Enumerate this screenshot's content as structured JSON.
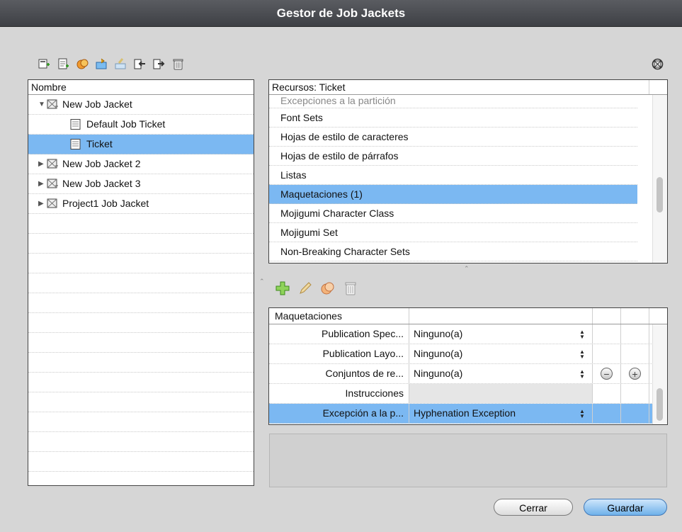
{
  "window": {
    "title": "Gestor de Job Jackets"
  },
  "toolbar": {
    "icons": [
      "new-job-jacket-icon",
      "new-ticket-icon",
      "duplicate-icon",
      "link-icon",
      "edit-icon",
      "import-icon",
      "export-icon",
      "trash-icon"
    ],
    "right_icon": "job-jacket-settings-icon"
  },
  "tree": {
    "header": "Nombre",
    "items": [
      {
        "label": "New Job Jacket",
        "level": 0,
        "expanded": true,
        "type": "jacket"
      },
      {
        "label": "Default Job Ticket",
        "level": 1,
        "type": "ticket"
      },
      {
        "label": "Ticket",
        "level": 1,
        "type": "ticket",
        "selected": true
      },
      {
        "label": "New Job Jacket 2",
        "level": 0,
        "expanded": false,
        "type": "jacket"
      },
      {
        "label": "New Job Jacket 3",
        "level": 0,
        "expanded": false,
        "type": "jacket"
      },
      {
        "label": "Project1 Job Jacket",
        "level": 0,
        "expanded": false,
        "type": "jacket"
      }
    ]
  },
  "resources": {
    "header": "Recursos: Ticket",
    "partial_item": "Excepciones a la partición",
    "items": [
      "Font Sets",
      "Hojas de estilo de caracteres",
      "Hojas de estilo de párrafos",
      "Listas",
      "Maquetaciones (1)",
      "Mojigumi Character Class",
      "Mojigumi Set",
      "Non-Breaking Character Sets"
    ],
    "selected": "Maquetaciones (1)"
  },
  "edit_toolbar": {
    "icons": [
      "add-icon",
      "edit-pencil-icon",
      "duplicate-icon",
      "trash-icon"
    ]
  },
  "layouts": {
    "header": "Maquetaciones",
    "rows": [
      {
        "name": "Publication Spec...",
        "value": "Ninguno(a)"
      },
      {
        "name": "Publication Layo...",
        "value": "Ninguno(a)"
      },
      {
        "name": "Conjuntos de re...",
        "value": "Ninguno(a)"
      },
      {
        "name": "Instrucciones",
        "value": ""
      },
      {
        "name": "Excepción a la p...",
        "value": "Hyphenation Exception",
        "selected": true
      }
    ],
    "remove_symbol": "−",
    "add_symbol": "+"
  },
  "buttons": {
    "close": "Cerrar",
    "save": "Guardar"
  }
}
